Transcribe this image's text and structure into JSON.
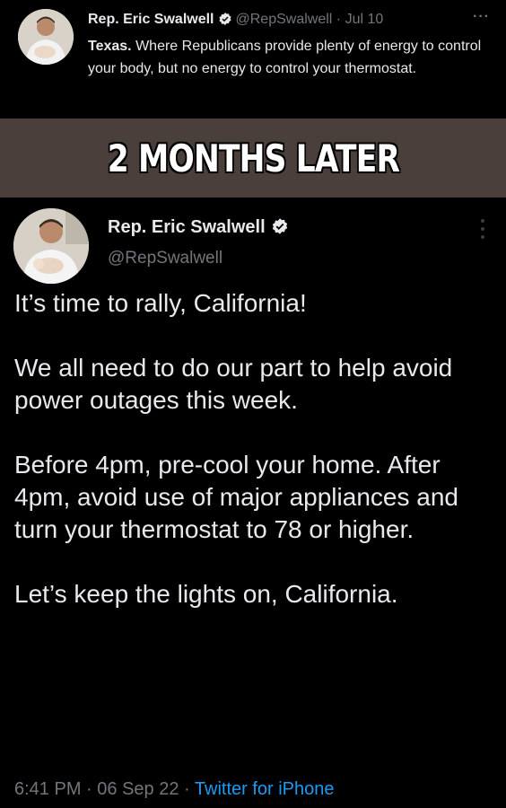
{
  "top_tweet": {
    "display_name": "Rep. Eric Swalwell",
    "handle": "@RepSwalwell",
    "separator": "·",
    "date": "Jul 10",
    "more_label": "···",
    "text_bold": "Texas.",
    "text_rest": " Where Republicans provide plenty of energy to control your body, but no energy to control your thermostat."
  },
  "banner": {
    "text": "2 MONTHS LATER"
  },
  "main_tweet": {
    "display_name": "Rep. Eric Swalwell",
    "handle": "@RepSwalwell",
    "paragraphs": [
      "It’s time to rally, California!",
      "We all need to do our part to help avoid power outages this week.",
      "Before 4pm, pre-cool your home. After 4pm, avoid use of major appliances and turn your thermostat to 78 or higher.",
      "Let’s keep the lights on, California."
    ],
    "time": "6:41 PM",
    "separator_1": " · ",
    "date": "06 Sep 22",
    "separator_2": " · ",
    "source": "Twitter for iPhone"
  },
  "colors": {
    "background": "#000000",
    "banner_bg": "#4a3f3b",
    "text": "#e7e9ea",
    "muted": "#71767b",
    "link": "#1d9bf0",
    "verified": "#e7e9ea"
  },
  "icons": {
    "verified": "verified-badge-icon",
    "more": "more-options-icon",
    "avatar": "profile-avatar"
  }
}
